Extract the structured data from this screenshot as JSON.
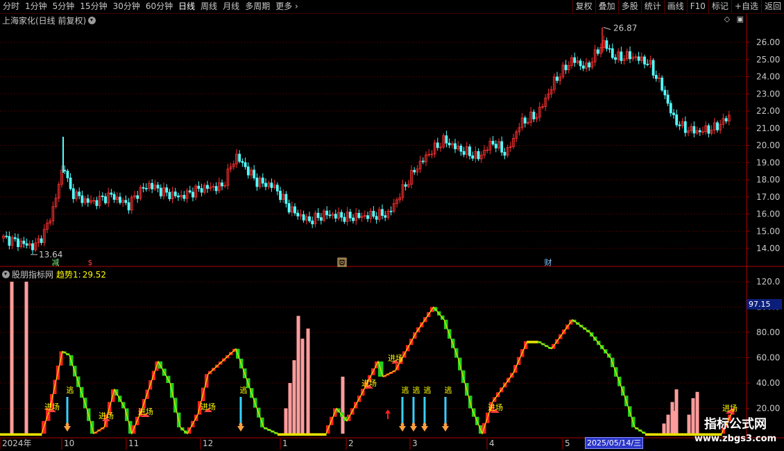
{
  "toolbar": {
    "periods": [
      "分时",
      "1分钟",
      "5分钟",
      "15分钟",
      "30分钟",
      "60分钟",
      "日线",
      "周线",
      "月线",
      "多周期",
      "更多"
    ],
    "active_period": "日线",
    "right_buttons": [
      "复权",
      "叠加",
      "多股",
      "统计",
      "画线",
      "F10",
      "标记",
      "+自选",
      "返回"
    ]
  },
  "main_panel": {
    "title": "上海家化(日线 前复权)",
    "high_label": "26.87",
    "low_label": "13.64",
    "event_markers": [
      "减",
      "$",
      "回",
      "财"
    ],
    "price_axis": [
      "26.00",
      "25.00",
      "24.00",
      "23.00",
      "22.00",
      "21.00",
      "20.00",
      "19.00",
      "18.00",
      "17.00",
      "16.00",
      "15.00",
      "14.00"
    ]
  },
  "indicator_panel": {
    "title": "股朋指标网",
    "series_label": "趋势1:",
    "series_value": "29.52",
    "last_value_tag": "97.15",
    "axis": [
      "120.0",
      "100.0",
      "80.00",
      "60.00",
      "40.00",
      "20.00"
    ],
    "entry_label": "进场",
    "escape_label": "逃"
  },
  "x_axis": {
    "labels": [
      "2024年",
      "10",
      "11",
      "12",
      "1",
      "2",
      "3",
      "4",
      "5"
    ],
    "cursor_date": "2025/05/14/三"
  },
  "colors": {
    "up_candle": "#ff3030",
    "down_candle": "#54ffff",
    "grid": "#7a0000",
    "trend_up": "#ff2020",
    "trend_down": "#20d020",
    "bar": "#ff9c9c",
    "signal": "#3ad0ff",
    "label": "#ffff00"
  },
  "watermark": {
    "title": "指标公式网",
    "url": "www.zbgs3.com"
  }
}
